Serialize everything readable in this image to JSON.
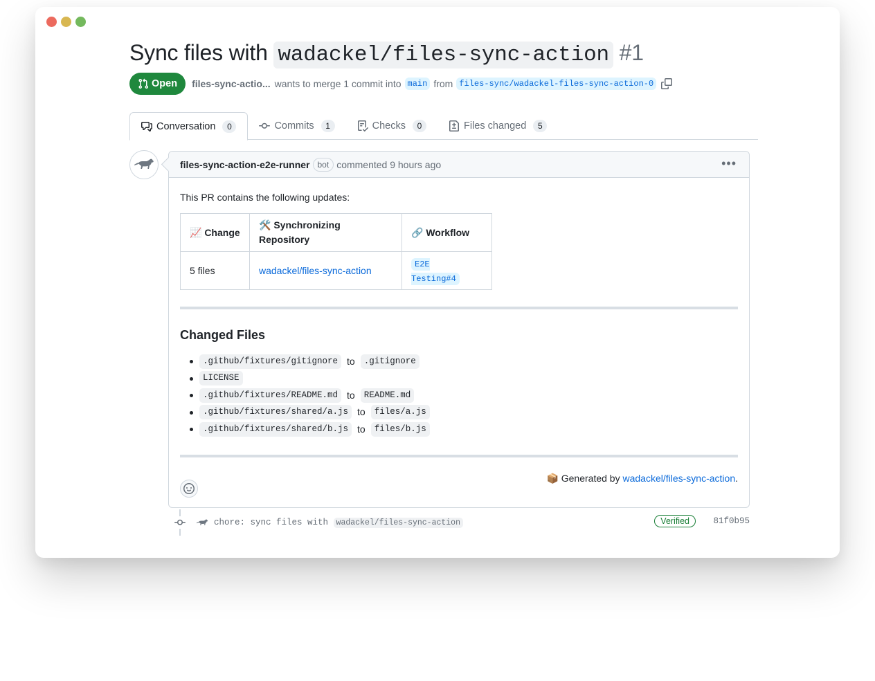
{
  "pr": {
    "title_prefix": "Sync files with ",
    "title_code": "wadackel/files-sync-action",
    "number": "#1",
    "state": "Open",
    "author": "files-sync-actio...",
    "merge_text": "wants to merge 1 commit into",
    "base_branch": "main",
    "from_text": "from",
    "head_branch": "files-sync/wadackel-files-sync-action-0"
  },
  "tabs": [
    {
      "label": "Conversation",
      "count": "0",
      "icon": "comment-discussion-icon"
    },
    {
      "label": "Commits",
      "count": "1",
      "icon": "git-commit-icon"
    },
    {
      "label": "Checks",
      "count": "0",
      "icon": "checklist-icon"
    },
    {
      "label": "Files changed",
      "count": "5",
      "icon": "file-diff-icon"
    }
  ],
  "comment": {
    "author": "files-sync-action-e2e-runner",
    "badge": "bot",
    "action": "commented 9 hours ago",
    "intro": "This PR contains the following updates:",
    "table": {
      "headers": [
        "📈 Change",
        "🛠️ Synchronizing Repository",
        "🔗 Workflow"
      ],
      "row": {
        "change": "5 files",
        "repo": "wadackel/files-sync-action",
        "workflow": "E2E Testing#4"
      }
    },
    "changed_heading": "Changed Files",
    "files": [
      {
        "from": ".github/fixtures/gitignore",
        "to": ".gitignore"
      },
      {
        "from": "LICENSE",
        "to": ""
      },
      {
        "from": ".github/fixtures/README.md",
        "to": "README.md"
      },
      {
        "from": ".github/fixtures/shared/a.js",
        "to": "files/a.js"
      },
      {
        "from": ".github/fixtures/shared/b.js",
        "to": "files/b.js"
      }
    ],
    "to_word": "to",
    "generated_prefix": "📦 Generated by ",
    "generated_link": "wadackel/files-sync-action",
    "generated_suffix": "."
  },
  "commit": {
    "message_prefix": "chore: sync files with",
    "message_code": "wadackel/files-sync-action",
    "verified": "Verified",
    "sha": "81f0b95"
  },
  "colors": {
    "open_green": "#1f883d",
    "link_blue": "#0969da",
    "verified_green": "#1a7f37"
  }
}
